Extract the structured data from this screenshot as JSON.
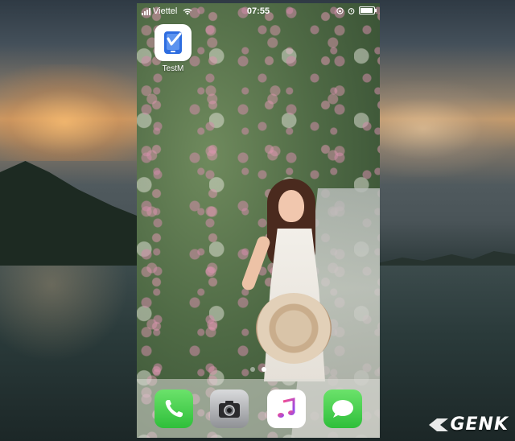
{
  "status_bar": {
    "carrier": "Viettel",
    "time": "07:55"
  },
  "home_screen": {
    "apps": [
      {
        "label": "TestM",
        "icon": "testm-icon"
      }
    ],
    "page_count": 2,
    "current_page": 2
  },
  "dock": {
    "apps": [
      {
        "icon": "phone-icon"
      },
      {
        "icon": "camera-icon"
      },
      {
        "icon": "music-icon"
      },
      {
        "icon": "messages-icon"
      }
    ]
  },
  "watermark": {
    "text": "GENK"
  }
}
